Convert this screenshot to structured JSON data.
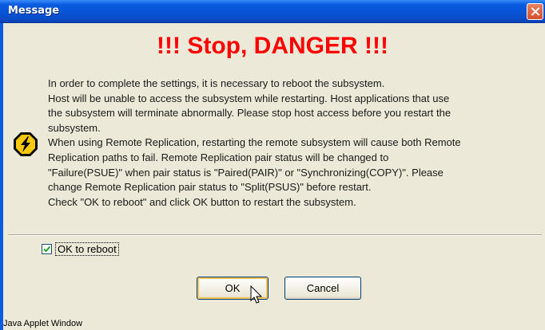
{
  "window": {
    "title": "Message"
  },
  "heading": "!!! Stop, DANGER !!!",
  "message_lines": [
    "In order to complete the settings, it is necessary to reboot the subsystem.",
    "Host will be unable to access the subsystem while restarting. Host applications that use",
    "the subsystem will terminate abnormally. Please stop host access before you restart the",
    "subsystem.",
    "When using Remote Replication, restarting the remote subsystem will cause both Remote",
    "Replication paths to fail. Remote Replication pair status will be changed to",
    "\"Failure(PSUE)\" when pair status is \"Paired(PAIR)\" or \"Synchronizing(COPY)\". Please",
    "change Remote Replication pair status to \"Split(PSUS)\" before restart.",
    "Check \"OK to reboot\" and click OK button to restart the subsystem."
  ],
  "checkbox": {
    "label": "OK to reboot",
    "checked": true
  },
  "buttons": {
    "ok": "OK",
    "cancel": "Cancel"
  },
  "footer": "Java Applet Window",
  "icons": {
    "close": "close-icon",
    "warning": "lightning-warning-icon",
    "cursor": "mouse-pointer-icon"
  },
  "colors": {
    "heading": "#ff0000",
    "titlebar": "#0a5ce0",
    "background": "#ece9d8"
  }
}
